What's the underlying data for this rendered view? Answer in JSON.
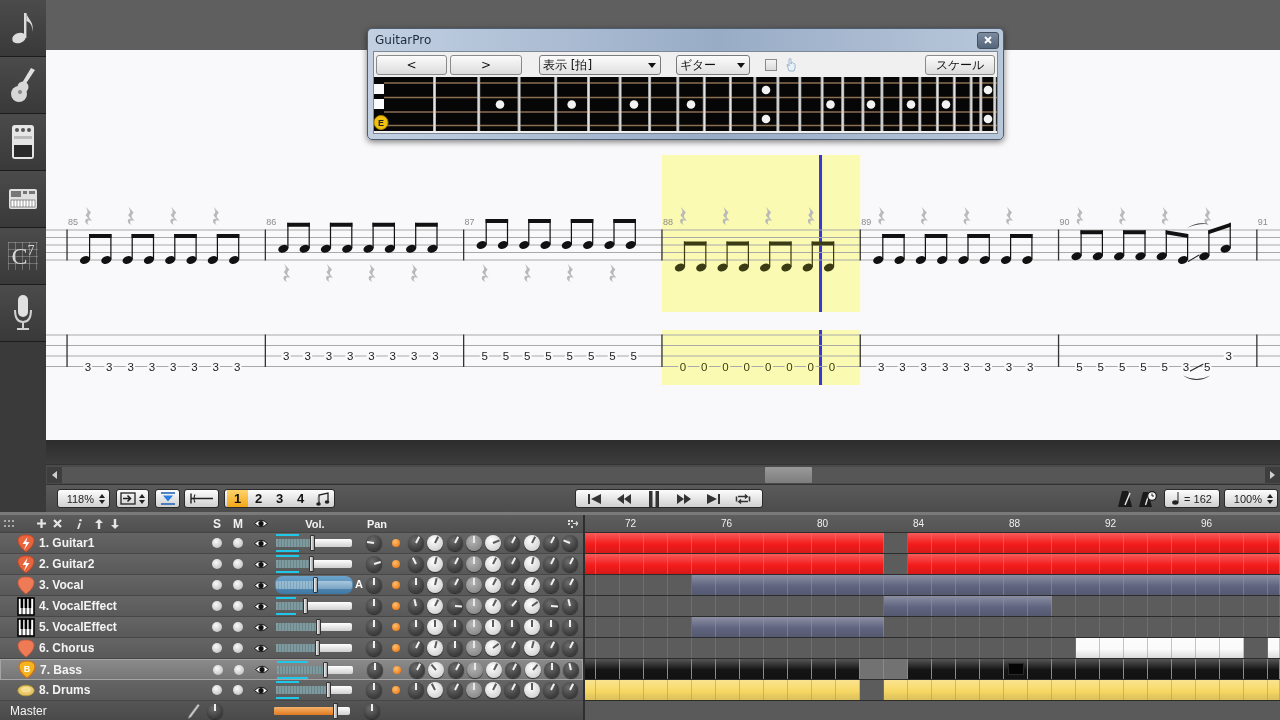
{
  "sidebar": {
    "items": [
      {
        "kind": "note"
      },
      {
        "kind": "guitar"
      },
      {
        "kind": "pedal"
      },
      {
        "kind": "synth"
      },
      {
        "kind": "chord",
        "label": "C$^{7}$"
      },
      {
        "kind": "microphone"
      }
    ]
  },
  "fretboard_window": {
    "title": "GuitarPro",
    "prev_button": "<",
    "next_button": ">",
    "view_select": "表示 [拍]",
    "instrument_select": "ギター",
    "checkbox": {
      "checked": false
    },
    "scale_button": "スケール",
    "fretboard": {
      "note": "E"
    }
  },
  "score": {
    "measures": [
      {
        "number": "85",
        "selected": false,
        "rests": [
          {
            "kind": "high"
          },
          {
            "kind": "high"
          },
          {
            "kind": "high"
          },
          {
            "kind": "high"
          }
        ],
        "notes": [
          {
            "fret": "3",
            "kind": "g2e"
          },
          {
            "fret": "3",
            "kind": "g2e"
          },
          {
            "fret": "3",
            "kind": "g2e"
          },
          {
            "fret": "3",
            "kind": "g2e"
          },
          {
            "fret": "3",
            "kind": "g2e"
          },
          {
            "fret": "3",
            "kind": "g2e"
          },
          {
            "fret": "3",
            "kind": "g2e"
          },
          {
            "fret": "3",
            "kind": "g2e"
          }
        ]
      },
      {
        "number": "86",
        "selected": false,
        "rests": [
          {
            "kind": "low"
          },
          {
            "kind": "low"
          },
          {
            "kind": "low"
          },
          {
            "kind": "low"
          }
        ],
        "notes": [
          {
            "fret": "3",
            "kind": "c3a"
          },
          {
            "fret": "3",
            "kind": "c3a"
          },
          {
            "fret": "3",
            "kind": "c3a"
          },
          {
            "fret": "3",
            "kind": "c3a"
          },
          {
            "fret": "3",
            "kind": "c3a"
          },
          {
            "fret": "3",
            "kind": "c3a"
          },
          {
            "fret": "3",
            "kind": "c3a"
          },
          {
            "fret": "3",
            "kind": "c3a"
          }
        ]
      },
      {
        "number": "87",
        "selected": false,
        "rests": [
          {
            "kind": "low"
          },
          {
            "kind": "low"
          },
          {
            "kind": "low"
          },
          {
            "kind": "low"
          }
        ],
        "notes": [
          {
            "fret": "5",
            "kind": "d3a"
          },
          {
            "fret": "5",
            "kind": "d3a"
          },
          {
            "fret": "5",
            "kind": "d3a"
          },
          {
            "fret": "5",
            "kind": "d3a"
          },
          {
            "fret": "5",
            "kind": "d3a"
          },
          {
            "fret": "5",
            "kind": "d3a"
          },
          {
            "fret": "5",
            "kind": "d3a"
          },
          {
            "fret": "5",
            "kind": "d3a"
          }
        ]
      },
      {
        "number": "88",
        "selected": true,
        "cursor": {
          "level": 0.8
        },
        "rests": [
          {
            "kind": "high"
          },
          {
            "kind": "high"
          },
          {
            "kind": "high"
          },
          {
            "kind": "high"
          }
        ],
        "notes": [
          {
            "fret": "0",
            "kind": "e2e"
          },
          {
            "fret": "0",
            "kind": "e2e"
          },
          {
            "fret": "0",
            "kind": "e2e"
          },
          {
            "fret": "0",
            "kind": "e2e"
          },
          {
            "fret": "0",
            "kind": "e2e"
          },
          {
            "fret": "0",
            "kind": "e2e"
          },
          {
            "fret": "0",
            "kind": "e2e"
          },
          {
            "fret": "0",
            "kind": "e2e"
          }
        ]
      },
      {
        "number": "89",
        "selected": false,
        "rests": [
          {
            "kind": "high"
          },
          {
            "kind": "high"
          },
          {
            "kind": "high"
          },
          {
            "kind": "high"
          }
        ],
        "notes": [
          {
            "fret": "3",
            "kind": "g2e"
          },
          {
            "fret": "3",
            "kind": "g2e"
          },
          {
            "fret": "3",
            "kind": "g2e"
          },
          {
            "fret": "3",
            "kind": "g2e"
          },
          {
            "fret": "3",
            "kind": "g2e"
          },
          {
            "fret": "3",
            "kind": "g2e"
          },
          {
            "fret": "3",
            "kind": "g2e"
          },
          {
            "fret": "3",
            "kind": "g2e"
          }
        ]
      },
      {
        "number": "90",
        "selected": false,
        "rests": [
          {
            "kind": "high"
          },
          {
            "kind": "high"
          },
          {
            "kind": "high"
          },
          {
            "kind": "high"
          }
        ],
        "notes": [
          {
            "fret": "5",
            "kind": "a2e"
          },
          {
            "fret": "5",
            "kind": "a2e"
          },
          {
            "fret": "5",
            "kind": "a2e"
          },
          {
            "fret": "5",
            "kind": "a2e"
          },
          {
            "fret": "5",
            "kind": "a2e"
          },
          {
            "fret": "3",
            "kind": "g2e"
          },
          {
            "fret": "5",
            "kind": "a2e",
            "slide": true
          },
          {
            "fret": "3",
            "kind": "c3a"
          }
        ]
      },
      {
        "number": "91",
        "selected": false
      }
    ]
  },
  "toolbar": {
    "zoom": "118%",
    "voices": [
      {
        "label": "1",
        "selected": true
      },
      {
        "label": "2",
        "selected": false
      },
      {
        "label": "3",
        "selected": false
      },
      {
        "label": "4",
        "selected": false
      }
    ],
    "playing": true,
    "tempo": "= 162",
    "speed": "100%"
  },
  "track_panel": {
    "headers": {
      "solo": "S",
      "mute": "M",
      "volume": "Vol.",
      "pan": "Pan"
    },
    "tracks": [
      {
        "name": "1. Guitar1",
        "kind": "electric",
        "selected": false,
        "solo": false,
        "mute": false,
        "visible": true,
        "volume": {
          "level": 0.49
        },
        "meter": {
          "level": 0.3
        },
        "pan": {
          "level": 0.2
        },
        "fx": true,
        "knobs": [
          {
            "level": 0.6
          },
          {
            "level": 0.6
          },
          {
            "level": 0.6
          },
          {
            "level": 0.5
          },
          {
            "level": 0.75
          },
          {
            "level": 0.6
          },
          {
            "level": 0.6
          },
          {
            "level": 0.6
          },
          {
            "level": 0.25
          }
        ],
        "color": "#f41c1c",
        "bars": [
          true,
          true,
          true,
          true,
          true,
          true,
          true,
          true,
          true,
          true,
          true,
          true,
          true,
          false,
          true,
          true,
          true,
          true,
          true,
          true,
          true,
          true,
          true,
          true,
          true,
          true,
          true,
          true,
          true,
          true
        ]
      },
      {
        "name": "2. Guitar2",
        "kind": "electric",
        "selected": false,
        "solo": false,
        "mute": false,
        "visible": true,
        "volume": {
          "level": 0.47
        },
        "meter": {
          "level": 0.3
        },
        "pan": {
          "level": 0.77
        },
        "fx": true,
        "knobs": [
          {
            "level": 0.4
          },
          {
            "level": 0.55
          },
          {
            "level": 0.6
          },
          {
            "level": 0.5
          },
          {
            "level": 0.6
          },
          {
            "level": 0.6
          },
          {
            "level": 0.55
          },
          {
            "level": 0.6
          },
          {
            "level": 0.6
          }
        ],
        "color": "#f41c1c",
        "bars": [
          true,
          true,
          true,
          true,
          true,
          true,
          true,
          true,
          true,
          true,
          true,
          true,
          true,
          false,
          true,
          true,
          true,
          true,
          true,
          true,
          true,
          true,
          true,
          true,
          true,
          true,
          true,
          true,
          true,
          true
        ]
      },
      {
        "name": "3. Vocal",
        "kind": "pick",
        "selected": false,
        "solo": false,
        "mute": false,
        "visible": true,
        "volume": {
          "level": 0.53
        },
        "automation": "A",
        "pan": {
          "level": 0.5
        },
        "fx": true,
        "knobs": [
          {
            "level": 0.5
          },
          {
            "level": 0.55
          },
          {
            "level": 0.6
          },
          {
            "level": 0.5
          },
          {
            "level": 0.6
          },
          {
            "level": 0.6
          },
          {
            "level": 0.6
          },
          {
            "level": 0.6
          },
          {
            "level": 0.6
          }
        ],
        "color": "#60647f",
        "bars": [
          false,
          false,
          false,
          false,
          false,
          true,
          true,
          true,
          true,
          true,
          true,
          true,
          true,
          true,
          true,
          true,
          true,
          true,
          true,
          true,
          true,
          true,
          true,
          true,
          true,
          true,
          true,
          true,
          true,
          true
        ]
      },
      {
        "name": "4. VocalEffect",
        "kind": "keys",
        "selected": false,
        "solo": false,
        "mute": false,
        "visible": true,
        "volume": {
          "level": 0.4
        },
        "meter": {
          "level": 0.25
        },
        "pan": {
          "level": 0.5
        },
        "fx": true,
        "knobs": [
          {
            "level": 0.45
          },
          {
            "level": 0.6
          },
          {
            "level": 0.85
          },
          {
            "level": 0.5
          },
          {
            "level": 0.6
          },
          {
            "level": 0.65
          },
          {
            "level": 0.7
          },
          {
            "level": 0.85
          },
          {
            "level": 0.45
          }
        ],
        "color": "#60647f",
        "bars": [
          false,
          false,
          false,
          false,
          false,
          false,
          false,
          false,
          false,
          false,
          false,
          false,
          false,
          true,
          true,
          true,
          true,
          true,
          true,
          true,
          false,
          false,
          false,
          false,
          false,
          false,
          false,
          false,
          false,
          false
        ]
      },
      {
        "name": "5. VocalEffect",
        "kind": "keys",
        "selected": false,
        "solo": false,
        "mute": false,
        "visible": true,
        "volume": {
          "level": 0.56
        },
        "pan": {
          "level": 0.5
        },
        "fx": true,
        "knobs": [
          {
            "level": 0.5
          },
          {
            "level": 0.5
          },
          {
            "level": 0.5
          },
          {
            "level": 0.5
          },
          {
            "level": 0.5
          },
          {
            "level": 0.5
          },
          {
            "level": 0.5
          },
          {
            "level": 0.5
          },
          {
            "level": 0.5
          }
        ],
        "color": "#60647f",
        "bars": [
          false,
          false,
          false,
          false,
          false,
          true,
          true,
          true,
          true,
          true,
          true,
          true,
          true,
          false,
          false,
          false,
          false,
          false,
          false,
          false,
          false,
          false,
          false,
          false,
          false,
          false,
          false,
          false,
          false,
          false
        ]
      },
      {
        "name": "6. Chorus",
        "kind": "pick",
        "selected": false,
        "solo": false,
        "mute": false,
        "visible": true,
        "volume": {
          "level": 0.55
        },
        "pan": {
          "level": 0.5
        },
        "fx": true,
        "knobs": [
          {
            "level": 0.6
          },
          {
            "level": 0.55
          },
          {
            "level": 0.5
          },
          {
            "level": 0.5
          },
          {
            "level": 0.7
          },
          {
            "level": 0.6
          },
          {
            "level": 0.55
          },
          {
            "level": 0.6
          },
          {
            "level": 0.6
          }
        ],
        "color": "#fbfbfb",
        "bars": [
          false,
          false,
          false,
          false,
          false,
          false,
          false,
          false,
          false,
          false,
          false,
          false,
          false,
          false,
          false,
          false,
          false,
          false,
          false,
          false,
          false,
          true,
          true,
          true,
          true,
          true,
          true,
          true,
          false,
          true
        ]
      },
      {
        "name": "7. Bass",
        "kind": "bass",
        "badge": "B",
        "selected": true,
        "solo": false,
        "mute": false,
        "visible": true,
        "volume": {
          "level": 0.64
        },
        "meter": {
          "level": 0.4
        },
        "pan": {
          "level": 0.5
        },
        "fx": true,
        "knobs": [
          {
            "level": 0.6
          },
          {
            "level": 0.35
          },
          {
            "level": 0.6
          },
          {
            "level": 0.5
          },
          {
            "level": 0.6
          },
          {
            "level": 0.6
          },
          {
            "level": 0.65
          },
          {
            "level": 0.5
          },
          {
            "level": 0.45
          }
        ],
        "color": "#141414",
        "playhead": {
          "level": 0.62
        },
        "bars": [
          true,
          true,
          true,
          true,
          true,
          true,
          true,
          true,
          true,
          true,
          true,
          true,
          false,
          false,
          true,
          true,
          true,
          true,
          true,
          true,
          true,
          true,
          true,
          true,
          true,
          true,
          true,
          true,
          true,
          true
        ]
      },
      {
        "name": "8. Drums",
        "kind": "drums",
        "selected": false,
        "solo": false,
        "mute": false,
        "visible": true,
        "volume": {
          "level": 0.69
        },
        "meter": {
          "level": 0.3
        },
        "pan": {
          "level": 0.5
        },
        "fx": true,
        "knobs": [
          {
            "level": 0.5
          },
          {
            "level": 0.4
          },
          {
            "level": 0.6
          },
          {
            "level": 0.5
          },
          {
            "level": 0.6
          },
          {
            "level": 0.6
          },
          {
            "level": 0.5
          },
          {
            "level": 0.6
          },
          {
            "level": 0.6
          }
        ],
        "color": "#f8d966",
        "bars": [
          true,
          true,
          true,
          true,
          true,
          true,
          true,
          true,
          true,
          true,
          true,
          true,
          false,
          true,
          true,
          true,
          true,
          true,
          true,
          true,
          true,
          true,
          true,
          true,
          true,
          true,
          true,
          true,
          true,
          true
        ]
      }
    ],
    "master": {
      "name": "Master",
      "knob": {
        "level": 0.5
      },
      "volume": {
        "level": 0.81
      },
      "pan": {
        "level": 0.5
      }
    }
  },
  "timeline": {
    "ruler": [
      "72",
      "76",
      "80",
      "84",
      "88",
      "92",
      "96"
    ]
  }
}
